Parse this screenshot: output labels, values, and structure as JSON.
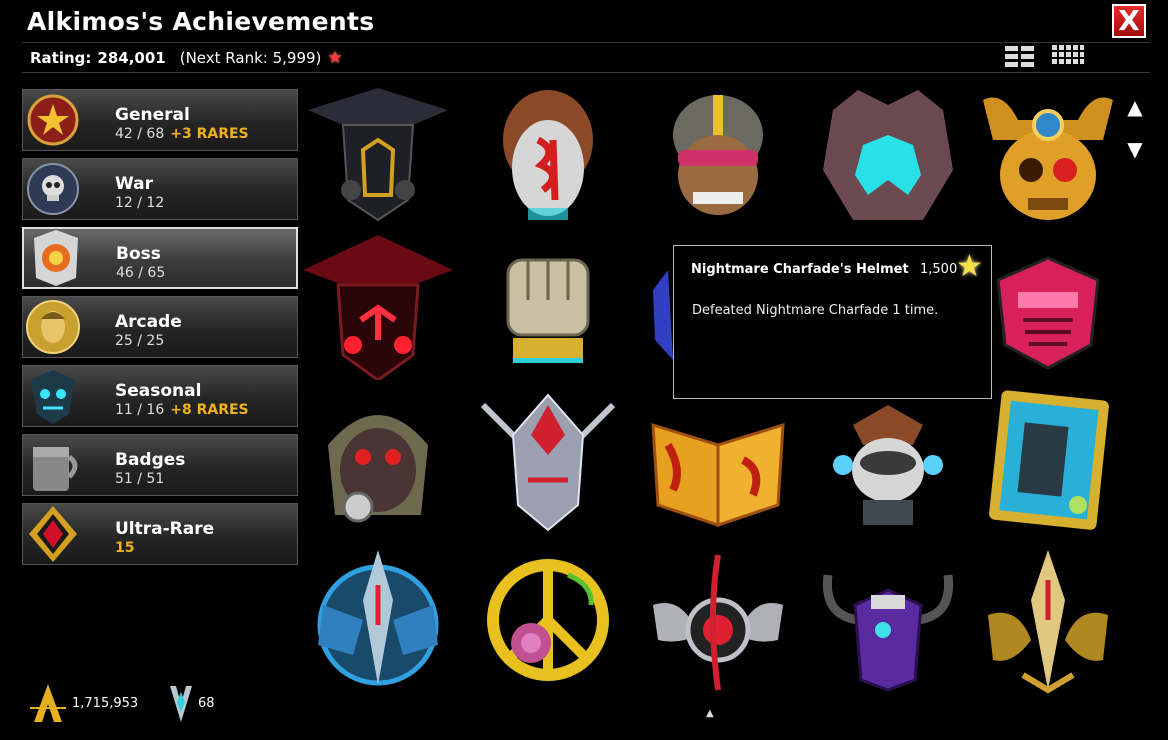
{
  "window": {
    "title": "Alkimos's Achievements",
    "close_label": "X"
  },
  "rating": {
    "label": "Rating:",
    "value": "284,001",
    "next_rank": "(Next Rank: 5,999)"
  },
  "categories": [
    {
      "name": "General",
      "count": "42 / 68",
      "rares": "+3 RARES",
      "color": "#b03020"
    },
    {
      "name": "War",
      "count": "12 / 12",
      "rares": "",
      "color": "#4a5a7a"
    },
    {
      "name": "Boss",
      "count": "46 / 65",
      "rares": "",
      "color": "#c05020"
    },
    {
      "name": "Arcade",
      "count": "25 / 25",
      "rares": "",
      "color": "#c8a030"
    },
    {
      "name": "Seasonal",
      "count": "11 / 16",
      "rares": "+8 RARES",
      "color": "#2a6a7a"
    },
    {
      "name": "Badges",
      "count": "51 / 51",
      "rares": "",
      "color": "#888888"
    },
    {
      "name": "Ultra-Rare",
      "count": "15",
      "rares": "",
      "color": "#c8102e"
    }
  ],
  "achievements": [
    {
      "icon": "dark-knight-helmet-icon",
      "color": "#d4a020"
    },
    {
      "icon": "red-tribal-mask-icon",
      "color": "#e03020"
    },
    {
      "icon": "goggled-warrior-icon",
      "color": "#c8b020"
    },
    {
      "icon": "cyan-crystal-demon-icon",
      "color": "#20d0d0"
    },
    {
      "icon": "golden-skull-icon",
      "color": "#e0a020"
    },
    {
      "icon": "nightmare-charfade-helmet-icon",
      "color": "#e02030"
    },
    {
      "icon": "stone-fist-icon",
      "color": "#c8c090"
    },
    {
      "icon": "blue-helm-icon",
      "color": "#3040c0"
    },
    {
      "icon": "pink-robot-helm-icon",
      "color": "#e03070"
    },
    {
      "icon": "hooded-gas-mask-icon",
      "color": "#8a8a60"
    },
    {
      "icon": "silver-horned-mask-icon",
      "color": "#c8ccd8"
    },
    {
      "icon": "flaming-book-icon",
      "color": "#e8a020"
    },
    {
      "icon": "cyber-hero-icon",
      "color": "#60c0e0"
    },
    {
      "icon": "tech-tablet-icon",
      "color": "#40c8e8"
    },
    {
      "icon": "ice-dragon-crest-icon",
      "color": "#30a0e0"
    },
    {
      "icon": "golden-peace-rose-icon",
      "color": "#e8c020"
    },
    {
      "icon": "winged-blade-icon",
      "color": "#c0c0c8"
    },
    {
      "icon": "purple-horned-helm-icon",
      "color": "#7030c0"
    },
    {
      "icon": "golden-dragon-crest-icon",
      "color": "#d0a030"
    }
  ],
  "tooltip": {
    "title": "Nightmare Charfade's Helmet",
    "points": "1,500",
    "description": "Defeated Nightmare Charfade 1 time."
  },
  "footer": {
    "ac_total": "1,715,953",
    "ultra_total": "68"
  }
}
